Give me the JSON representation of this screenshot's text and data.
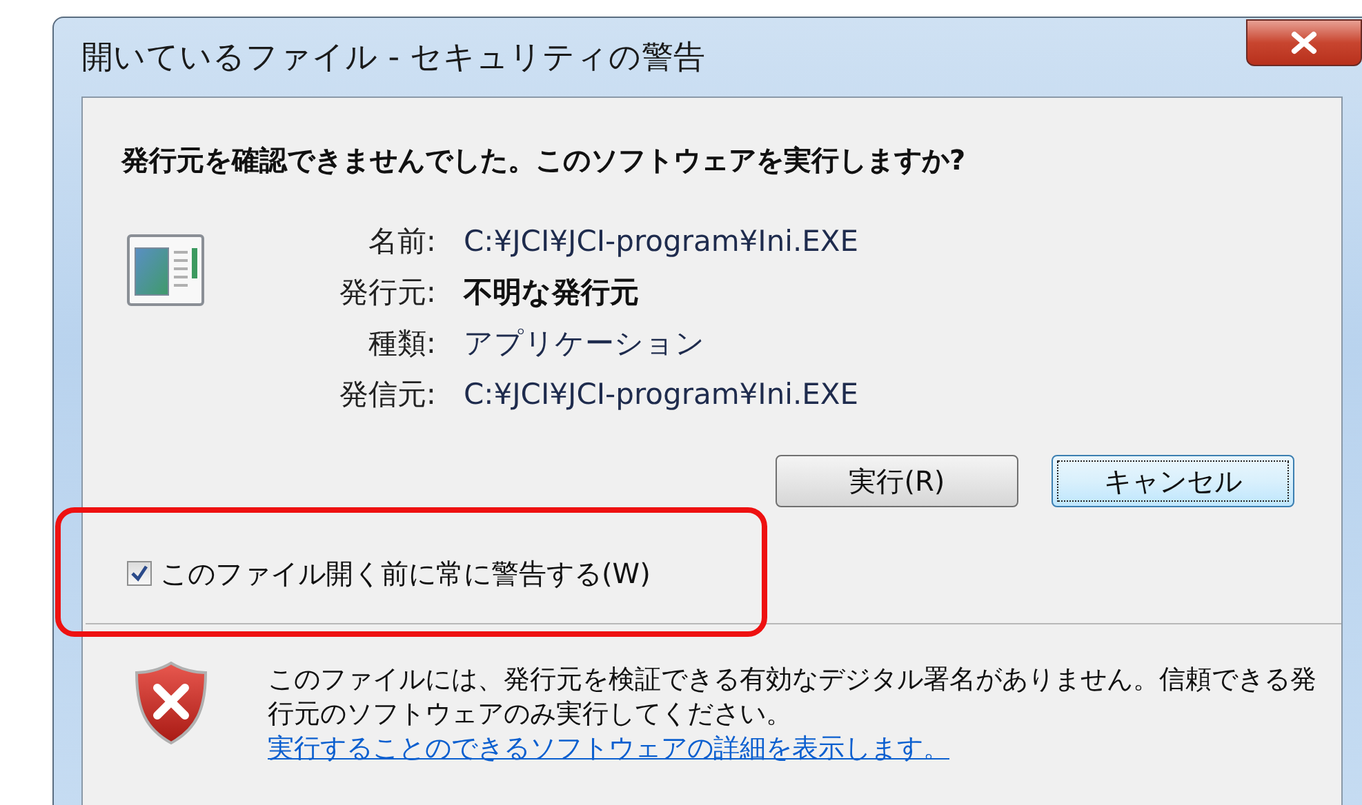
{
  "window": {
    "title": "開いているファイル - セキュリティの警告"
  },
  "heading": "発行元を確認できませんでした。このソフトウェアを実行しますか?",
  "details": [
    {
      "label": "名前:",
      "value": "C:¥JCI¥JCI-program¥Ini.EXE",
      "bold": false
    },
    {
      "label": "発行元:",
      "value": "不明な発行元",
      "bold": true
    },
    {
      "label": "種類:",
      "value": "アプリケーション",
      "bold": false
    },
    {
      "label": "発信元:",
      "value": "C:¥JCI¥JCI-program¥Ini.EXE",
      "bold": false
    }
  ],
  "buttons": [
    {
      "label": "実行(R)",
      "focused": false
    },
    {
      "label": "キャンセル",
      "focused": true
    }
  ],
  "checkbox": {
    "label": "このファイル開く前に常に警告する(W)",
    "checked": true
  },
  "footer": {
    "text": "このファイルには、発行元を検証できる有効なデジタル署名がありません。信頼できる発行元のソフトウェアのみ実行してください。",
    "link": "実行することのできるソフトウェアの詳細を表示します。"
  }
}
